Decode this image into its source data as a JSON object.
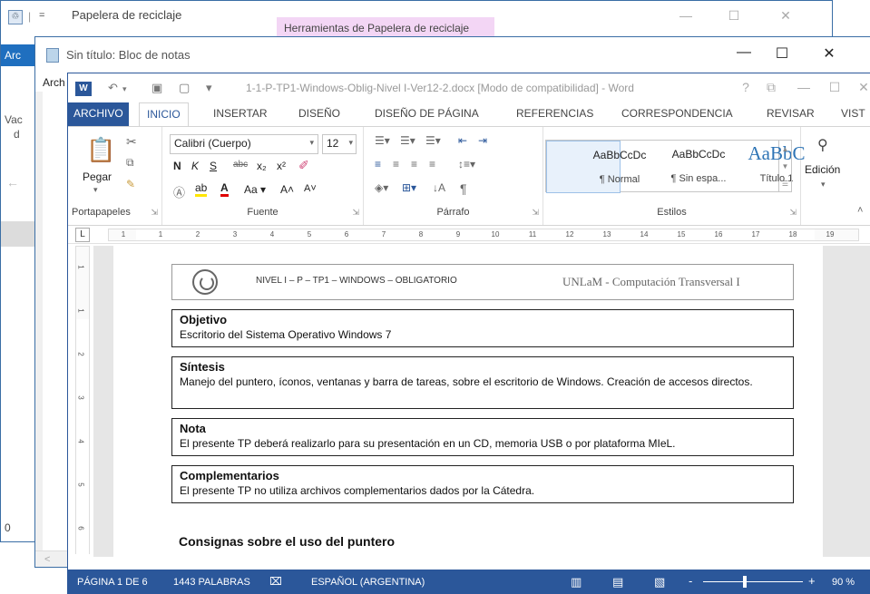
{
  "recycle_bin": {
    "qa_glyph": "=",
    "title": "Papelera de reciclaje",
    "tools_tab": "Herramientas de Papelera de reciclaje",
    "file_tab": "Arc",
    "side_text_1": "Vac",
    "side_text_2": "d",
    "count_text": "0"
  },
  "notepad": {
    "title": "Sin título: Bloc de notas",
    "menu_label": "Arch"
  },
  "word": {
    "doc_title": "1-1-P-TP1-Windows-Oblig-Nivel I-Ver12-2.docx [Modo de compatibilidad] - Word",
    "help_glyph": "?",
    "tabs": {
      "archivo": "ARCHIVO",
      "inicio": "INICIO",
      "insertar": "INSERTAR",
      "diseno": "DISEÑO",
      "diseno_pagina": "DISEÑO DE PÁGINA",
      "referencias": "REFERENCIAS",
      "correspondencia": "CORRESPONDENCIA",
      "revisar": "REVISAR",
      "vista": "VIST"
    },
    "ribbon": {
      "paste_label": "Pegar",
      "group_clipboard": "Portapapeles",
      "font_name": "Calibri (Cuerpo)",
      "font_size": "12",
      "group_font": "Fuente",
      "group_paragraph": "Párrafo",
      "group_styles": "Estilos",
      "edit_label": "Edición",
      "styles": [
        {
          "sample": "AaBbCcDc",
          "name": "¶ Normal"
        },
        {
          "sample": "AaBbCcDc",
          "name": "¶ Sin espa..."
        },
        {
          "sample": "AaBbC",
          "name": "Título 1"
        }
      ]
    },
    "ruler_ticks": [
      "1",
      "1",
      "2",
      "3",
      "4",
      "5",
      "6",
      "7",
      "8",
      "9",
      "10",
      "11",
      "12",
      "13",
      "14",
      "15",
      "16",
      "17",
      "18",
      "19"
    ],
    "vruler_ticks": [
      "1",
      "1",
      "2",
      "3",
      "4",
      "5",
      "6"
    ],
    "document": {
      "header_mid": "NIVEL I – P – TP1 – WINDOWS – OBLIGATORIO",
      "header_right": "UNLaM - Computación Transversal I",
      "boxes": [
        {
          "title": "Objetivo",
          "text": "Escritorio del Sistema Operativo Windows 7"
        },
        {
          "title": "Síntesis",
          "text": "Manejo del puntero, íconos, ventanas y barra de tareas, sobre el escritorio de Windows. Creación de accesos directos."
        },
        {
          "title": "Nota",
          "text": "El presente TP deberá realizarlo para su presentación en un CD, memoria USB o por plataforma MIeL."
        },
        {
          "title": "Complementarios",
          "text": "El presente TP no utiliza archivos complementarios dados por la Cátedra."
        }
      ],
      "heading": "Consignas sobre el uso del puntero"
    },
    "status": {
      "page": "PÁGINA 1 DE 6",
      "words": "1443 PALABRAS",
      "language": "ESPAÑOL (ARGENTINA)",
      "zoom_minus": "-",
      "zoom_plus": "+",
      "zoom": "90 %",
      "zoom_level": 0.42
    },
    "colors": {
      "accent": "#2b579a",
      "tools_tab_bg": "#f3d6f5"
    }
  }
}
